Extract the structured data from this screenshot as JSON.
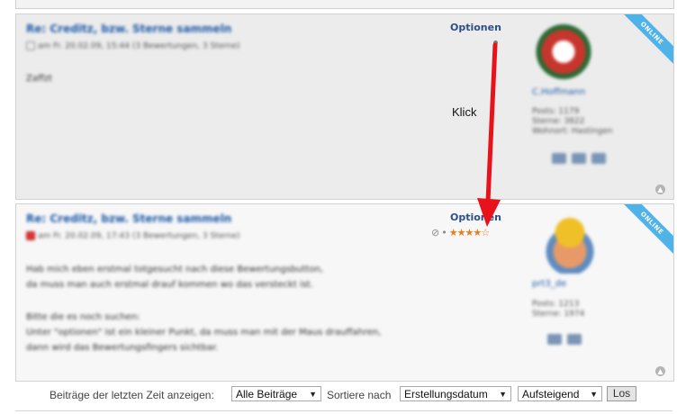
{
  "post1": {
    "title": "Re: Creditz, bzw. Sterne sammeln",
    "meta": "am Fr. 20.02.09, 15:44 (3 Bewertungen, 3 Sterne)",
    "body": [
      "Zaffzt"
    ],
    "options_label": "Optionen",
    "online_badge": "ONLINE",
    "username": "C.Hoffmann",
    "user_info": [
      "Posts: 1179",
      "Sterne: 3822",
      "Wohnort: Hastingen"
    ]
  },
  "annotation": {
    "klick_label": "Klick",
    "arrow_color": "#e8121b"
  },
  "post2": {
    "title": "Re: Creditz, bzw. Sterne sammeln",
    "meta": "am Fr. 20.02.09, 17:43 (3 Bewertungen, 3 Sterne)",
    "body": [
      "Hab mich eben erstmal totgesucht nach diese Bewertungsbutton,",
      "da muss man auch erstmal drauf kommen wo das versteckt ist.",
      "",
      "Bitte die es noch suchen:",
      "Unter \"optionen\" ist ein kleiner Punkt, da muss man mit der Maus drauffahren,",
      "dann wird das Bewertungsfingers sichtbar."
    ],
    "options_label": "Optionen",
    "online_badge": "ONLINE",
    "rating_filled": 4,
    "rating_max": 5,
    "username": "prt3_de",
    "user_info": [
      "Posts: 1213",
      "Sterne: 1974"
    ]
  },
  "footer": {
    "recent_label": "Beiträge der letzten Zeit anzeigen:",
    "recent_value": "Alle Beiträge",
    "sort_label": "Sortiere nach",
    "sort_value": "Erstellungsdatum",
    "order_value": "Aufsteigend",
    "go_button": "Los"
  },
  "colors": {
    "accent": "#2d4f87",
    "star": "#f07b16",
    "online": "#4fb3e8"
  }
}
